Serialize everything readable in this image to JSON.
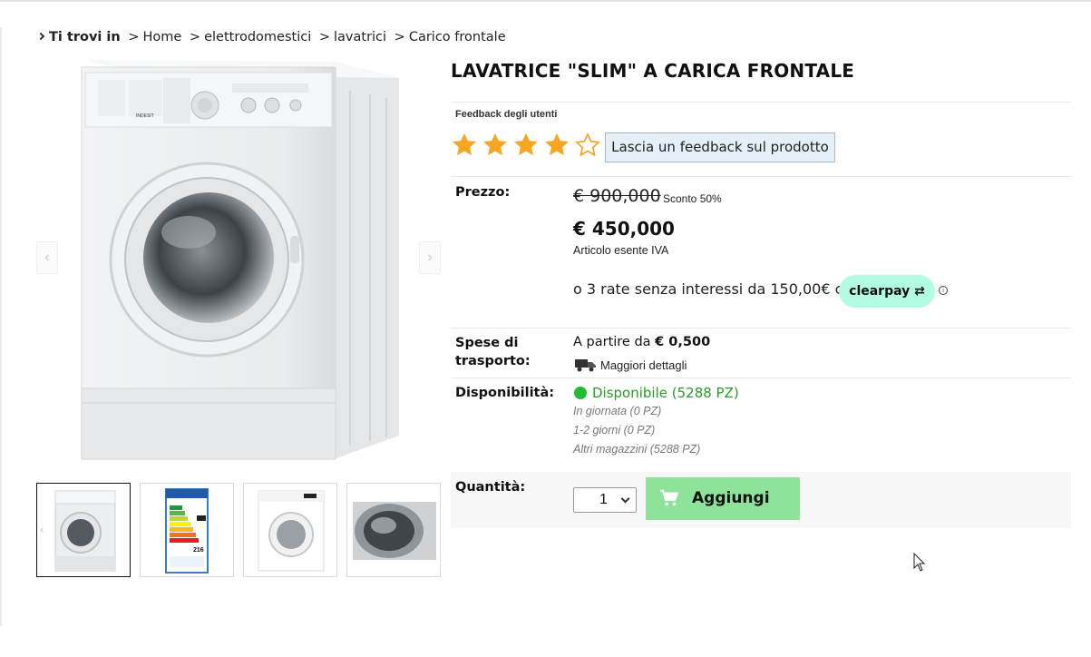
{
  "breadcrumb": {
    "prefix": "Ti trovi in",
    "items": [
      "Home",
      "elettrodomestici",
      "lavatrici",
      "Carico frontale"
    ],
    "separator": ">"
  },
  "product": {
    "title": "LAVATRICE \"SLIM\" A CARICA FRONTALE",
    "image_brand_text": "INDESIT"
  },
  "gallery": {
    "prev_arrow": "‹",
    "next_arrow": "›",
    "thumbnails": [
      {
        "label": "washing-machine-front-thumbnail",
        "active": true
      },
      {
        "label": "energy-label-thumbnail",
        "active": false,
        "energy_value": "216"
      },
      {
        "label": "washing-machine-white-thumbnail",
        "active": false
      },
      {
        "label": "drum-detail-thumbnail",
        "active": false
      }
    ]
  },
  "feedback": {
    "label": "Feedback degli utenti",
    "rating": 4,
    "max_rating": 5,
    "button_label": "Lascia un feedback sul prodotto",
    "star_color": "#f5a623"
  },
  "price": {
    "label": "Prezzo:",
    "old_price": "€ 900,000",
    "discount": "Sconto 50%",
    "new_price": "€ 450,000",
    "vat_note": "Articolo esente IVA",
    "installments_text": "o 3 rate senza interessi da 150,00€ con",
    "clearpay_label": "clearpay",
    "clearpay_color": "#b2fce4",
    "info_icon": "i"
  },
  "shipping": {
    "label_line1": "Spese di",
    "label_line2": "trasporto:",
    "from_text": "A partire da",
    "from_value": "€ 0,500",
    "details_link": "Maggiori dettagli"
  },
  "availability": {
    "label": "Disponibilità:",
    "status": "Disponibile (5288 PZ)",
    "status_color": "#22bb33",
    "details": [
      "In giornata (0 PZ)",
      "1-2 giorni (0 PZ)",
      "Altri magazzini (5288 PZ)"
    ]
  },
  "quantity": {
    "label": "Quantità:",
    "value": "1",
    "add_button": "Aggiungi",
    "add_button_color": "#8ee39a"
  }
}
